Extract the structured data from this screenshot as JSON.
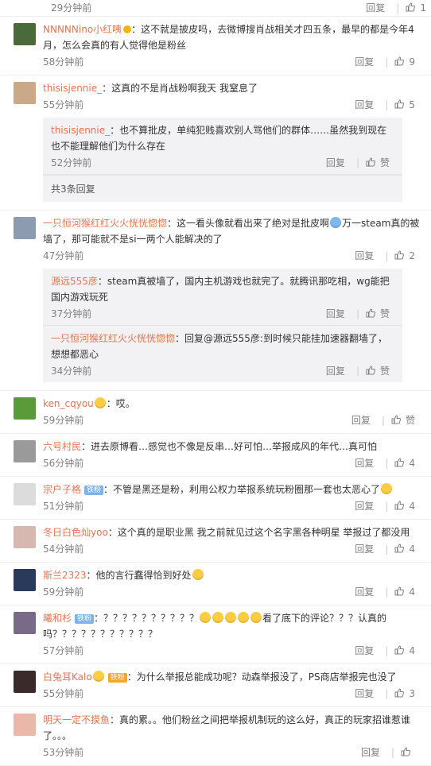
{
  "labels": {
    "reply": "回复",
    "like": "赞"
  },
  "colors": {
    "username": "#eb7350",
    "meta": "#808080",
    "sub_bg": "#f2f2f5"
  },
  "top_partial": {
    "time": "29分钟前",
    "likes": "1"
  },
  "comments": [
    {
      "user": "NNNNNino小红咦",
      "verified": true,
      "text": "：这不就是披皮吗，去微博搜肖战相关才四五条，最早的都是今年4月，怎么会真的有人觉得他是粉丝",
      "time": "58分钟前",
      "likes": "9",
      "avatar_color": "#4a6a3a"
    },
    {
      "user": "thisisjennie_",
      "text": "：这真的不是肖战粉啊我天 我窒息了",
      "time": "55分钟前",
      "likes": "5",
      "avatar_color": "#c9a98a",
      "replies": [
        {
          "user": "thisisjennie_",
          "text": "：也不算批皮，单纯犯贱喜欢别人骂他们的群体……虽然我到现在也不能理解他们为什么存在",
          "time": "52分钟前",
          "likes": "赞"
        }
      ],
      "more": "共3条回复"
    },
    {
      "user": "一只恒河猴红红火火恍恍惚惚",
      "text": "：这一看头像就看出来了绝对是批皮啊",
      "emoji_mid": true,
      "text2": "万一steam真的被墙了，那可能就不是si一两个人能解决的了",
      "time": "47分钟前",
      "likes": "2",
      "avatar_color": "#8d9bb0",
      "replies": [
        {
          "user": "源远555彦",
          "text": "：steam真被墙了，国内主机游戏也就完了。就腾讯那吃相，wg能把国内游戏玩死",
          "time": "37分钟前",
          "likes": "赞"
        },
        {
          "user": "一只恒河猴红红火火恍恍惚惚",
          "text": "：回复@源远555彦:到时候只能挂加速器翻墙了，想想都恶心",
          "time": "34分钟前",
          "likes": "赞"
        }
      ]
    },
    {
      "user": "ken_cqyou",
      "user_emoji": true,
      "text": "：哎。",
      "time": "59分钟前",
      "likes": "赞",
      "avatar_color": "#5a9a3a"
    },
    {
      "user": "六号村民",
      "text": "：进去原博看…感觉也不像是反串…好可怕…举报成风的年代…真可怕",
      "time": "56分钟前",
      "likes": "4",
      "avatar_color": "#9a9a9a"
    },
    {
      "user": "宗户子格",
      "badge": "铁粉",
      "text": "：不管是黑还是粉，利用公权力举报系统玩粉圈那一套也太恶心了",
      "emoji_end": true,
      "time": "51分钟前",
      "likes": "4",
      "avatar_color": "#dcdcdc"
    },
    {
      "user": "冬日白色灿yoo",
      "text": "：这个真的是职业黑 我之前就见过这个名字黑各种明星 举报过了都没用",
      "time": "54分钟前",
      "likes": "4",
      "avatar_color": "#d6b8b0"
    },
    {
      "user": "斯兰2323",
      "text": "：他的言行蠢得恰到好处",
      "emoji_end": true,
      "time": "59分钟前",
      "likes": "4",
      "avatar_color": "#2a3a5a"
    },
    {
      "user": "曦和杉",
      "badge": "铁粉",
      "text": "：？？？？？？？？？？",
      "emoji_count": 5,
      "text2": "看了底下的评论？？？认真的吗？？？？？？？？？？？",
      "time": "57分钟前",
      "likes": "4",
      "avatar_color": "#7a6a8a"
    },
    {
      "user": "白兔耳Kalo",
      "user_emoji": true,
      "badge_orange": "铁粉",
      "text": "：为什么举报总能成功呢？动森举报没了，PS商店举报完也没了",
      "time": "55分钟前",
      "likes": "3",
      "avatar_color": "#3a2a2a"
    },
    {
      "user": "明天一定不摸鱼",
      "text": "：真的累。。他们粉丝之间把举报机制玩的这么好，真正的玩家招谁惹谁了。。。",
      "time": "53分钟前",
      "likes": "",
      "avatar_color": "#e8b8a8"
    }
  ]
}
